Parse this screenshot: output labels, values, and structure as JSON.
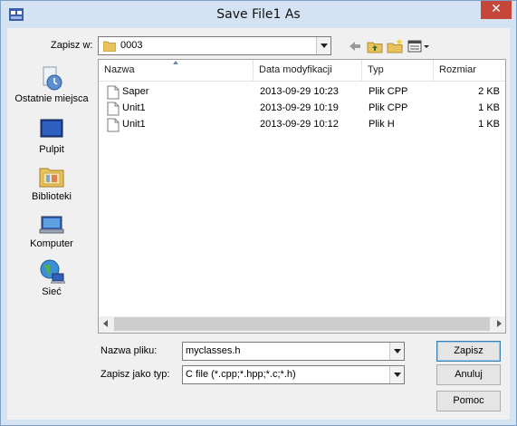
{
  "window": {
    "title": "Save File1 As",
    "close_glyph": "✕"
  },
  "lookin": {
    "label": "Zapisz w:",
    "value": "0003"
  },
  "places": [
    {
      "name": "place-recent",
      "icon": "recent-places-icon",
      "label": "Ostatnie miejsca"
    },
    {
      "name": "place-desktop",
      "icon": "desktop-icon",
      "label": "Pulpit"
    },
    {
      "name": "place-libraries",
      "icon": "libraries-icon",
      "label": "Biblioteki"
    },
    {
      "name": "place-computer",
      "icon": "computer-icon",
      "label": "Komputer"
    },
    {
      "name": "place-network",
      "icon": "network-icon",
      "label": "Sieć"
    }
  ],
  "columns": [
    "Nazwa",
    "Data modyfikacji",
    "Typ",
    "Rozmiar"
  ],
  "files": [
    {
      "name": "Saper",
      "date": "2013-09-29 10:23",
      "type": "Plik CPP",
      "size": "2 KB"
    },
    {
      "name": "Unit1",
      "date": "2013-09-29 10:19",
      "type": "Plik CPP",
      "size": "1 KB"
    },
    {
      "name": "Unit1",
      "date": "2013-09-29 10:12",
      "type": "Plik H",
      "size": "1 KB"
    }
  ],
  "filename": {
    "label": "Nazwa pliku:",
    "value": "myclasses.h"
  },
  "filetype": {
    "label": "Zapisz jako typ:",
    "value": "C file (*.cpp;*.hpp;*.c;*.h)"
  },
  "buttons": {
    "save": "Zapisz",
    "cancel": "Anuluj",
    "help": "Pomoc"
  },
  "colors": {
    "accent": "#3c7fb1",
    "folder": "#e8c25a",
    "close": "#c7463a"
  }
}
